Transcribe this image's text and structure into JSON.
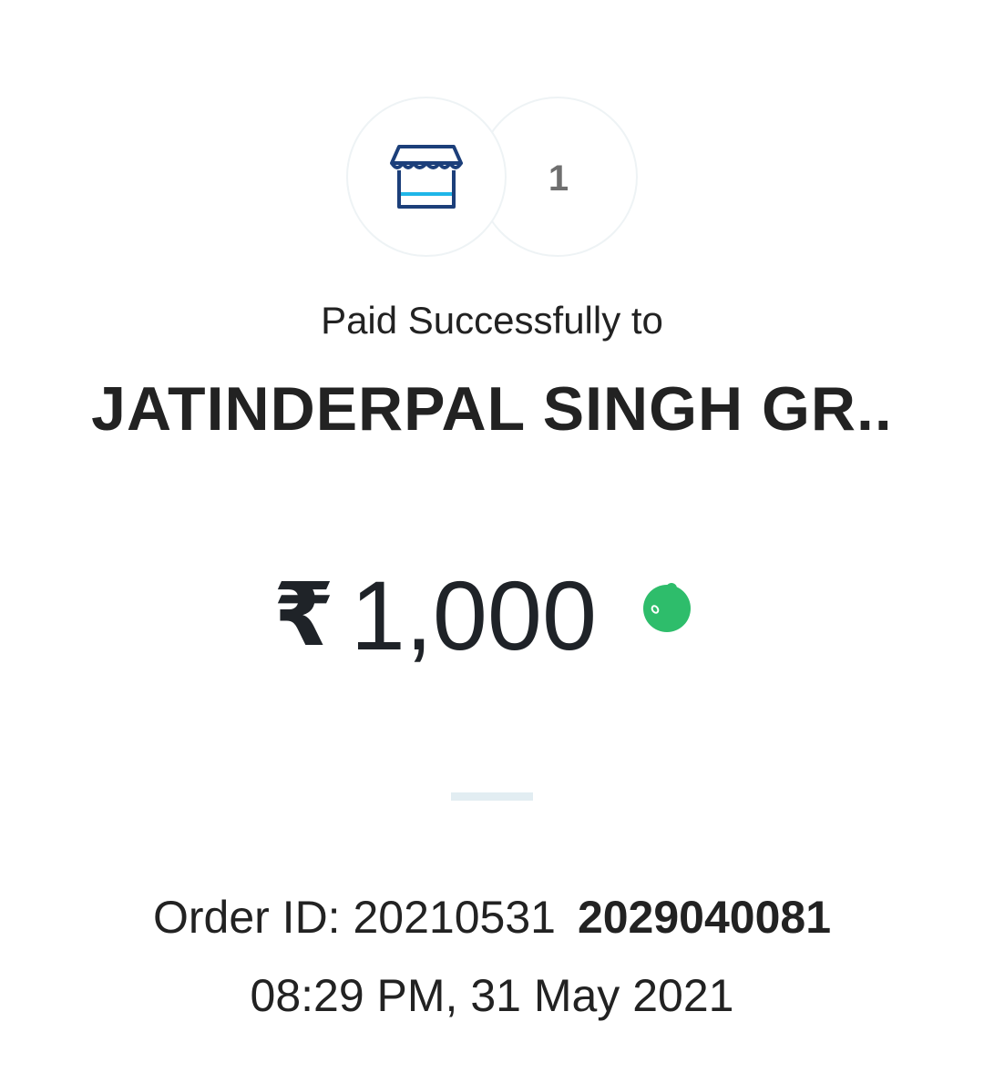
{
  "header": {
    "store_icon": "storefront-icon",
    "count_badge": "1"
  },
  "payment": {
    "status_text": "Paid Successfully to",
    "payee_name": "JATINDERPAL SINGH GR..",
    "currency_symbol": "₹",
    "amount": "1,000",
    "status_icon": "success-dot-icon"
  },
  "order": {
    "id_label": "Order ID: 20210531",
    "id_suffix": "2029040081",
    "datetime": "08:29 PM, 31 May 2021"
  },
  "colors": {
    "icon_blue": "#1c3f7a",
    "icon_accent": "#1fb6e8",
    "success_green": "#2ebd6b",
    "divider": "#e2edf2"
  }
}
